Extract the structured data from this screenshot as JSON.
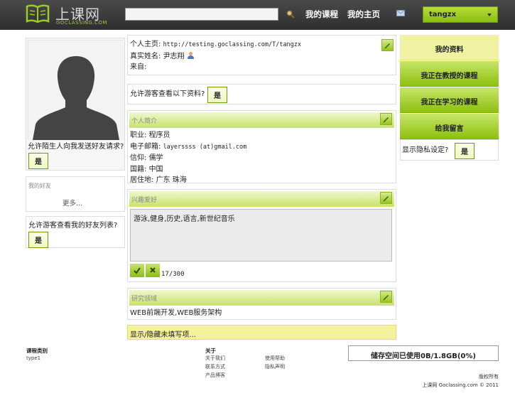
{
  "header": {
    "logo_cn": "上课网",
    "logo_en": "GOCLASSING.COM",
    "search": {
      "value": "",
      "placeholder": ""
    },
    "nav": [
      "我的课程",
      "我的主页"
    ],
    "user": "tangzx"
  },
  "left": {
    "allow_friend_request": "允许陌生人向我发送好友请求?",
    "yes": "是",
    "friends_title": "我的好友",
    "friends_more": "更多...",
    "allow_view_friends": "允许游客查看我的好友列表?"
  },
  "profile": {
    "homepage_label": "个人主页:",
    "homepage_url": "http://testing.goclassing.com/T/tangzx",
    "realname_label": "真实姓名:",
    "realname": "尹志翔",
    "from_label": "来自:",
    "from": ""
  },
  "guest_view": {
    "question": "允许游客查看以下资料?",
    "yes": "是"
  },
  "intro": {
    "title": "个人简介",
    "job_label": "职业:",
    "job": "程序员",
    "email_label": "电子邮箱:",
    "email": "layerssss (at)gmail.com",
    "belief_label": "信仰:",
    "belief": "儒学",
    "nationality_label": "国籍:",
    "nationality": "中国",
    "residence_label": "居住地:",
    "residence": "广东 珠海"
  },
  "hobbies": {
    "title": "兴趣爱好",
    "value": "游泳,健身,历史,语言,新世纪音乐",
    "counter": "17/300"
  },
  "research": {
    "title": "研究领域",
    "value": "WEB前端开发,WEB服务架构"
  },
  "toggle_empty": "显示/隐藏未填写项...",
  "menu": [
    "我的资料",
    "我正在教授的课程",
    "我正在学习的课程",
    "给我留言"
  ],
  "privacy": {
    "question": "显示隐私设定?",
    "yes": "是"
  },
  "footer": {
    "category_title": "课程类别",
    "category_item": "type1",
    "about_title": "关于",
    "about_links": [
      "关于我们",
      "联系方式",
      "产品博客"
    ],
    "help_links": [
      "使用帮助",
      "隐私声明"
    ],
    "storage": "储存空间已使用0B/1.8GB(0%)",
    "rights": "版权所有",
    "copyright": "上课网 Goclassing.com © 2011"
  },
  "colors": {
    "accent_green": "#9ccc2a",
    "topbar": "#3a3a3a",
    "highlight_yellow": "#f5f29c"
  }
}
